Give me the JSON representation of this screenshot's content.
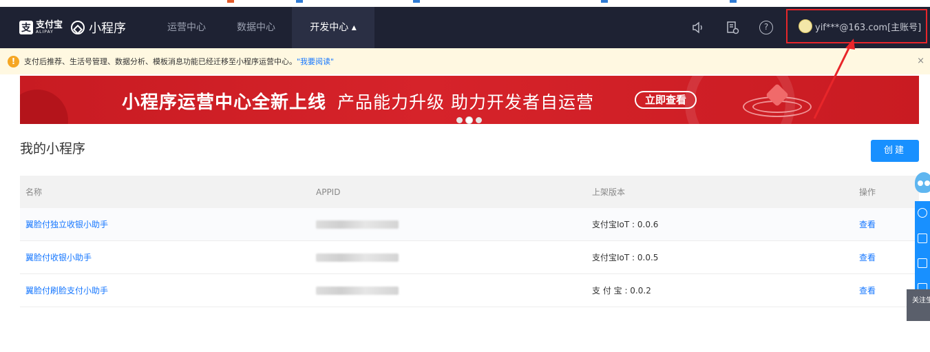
{
  "navbar": {
    "logo_cn": "支付宝",
    "logo_en": "ALIPAY",
    "product_name": "小程序",
    "nav_items": [
      {
        "label": "运营中心",
        "active": false
      },
      {
        "label": "数据中心",
        "active": false
      },
      {
        "label": "开发中心 ▴",
        "active": true
      }
    ],
    "icons": [
      "speaker-icon",
      "document-clock-icon",
      "help-icon"
    ],
    "account": "yif***@163.com[主账号]"
  },
  "notice": {
    "text": "支付后推荐、生活号管理、数据分析、模板消息功能已经迁移至小程序运营中心。",
    "link": "\"我要阅读\"",
    "close": "×"
  },
  "banner": {
    "title": "小程序运营中心全新上线",
    "subtitle": "产品能力升级   助力开发者自运营",
    "button": "立即查看",
    "active_slide": 2,
    "slide_count": 3
  },
  "main": {
    "title": "我的小程序",
    "create_button": "创建"
  },
  "table": {
    "columns": [
      "名称",
      "APPID",
      "上架版本",
      "操作"
    ],
    "rows": [
      {
        "name": "翼脸付独立收银小助手",
        "appid": "",
        "version": "支付宝IoT : 0.0.6",
        "action": "查看"
      },
      {
        "name": "翼脸付收银小助手",
        "appid": "",
        "version": "支付宝IoT : 0.0.5",
        "action": "查看"
      },
      {
        "name": "翼脸付刷脸支付小助手",
        "appid": "",
        "version": "支 付 宝 : 0.0.2",
        "action": "查看"
      }
    ]
  },
  "side_panel": {
    "grey_text": "关注生活号"
  },
  "colors": {
    "navbar": "#1e2233",
    "accent": "#1890ff",
    "banner": "#d6232a",
    "highlight_box": "#e8262a",
    "notice_bg": "#fff8e1"
  }
}
